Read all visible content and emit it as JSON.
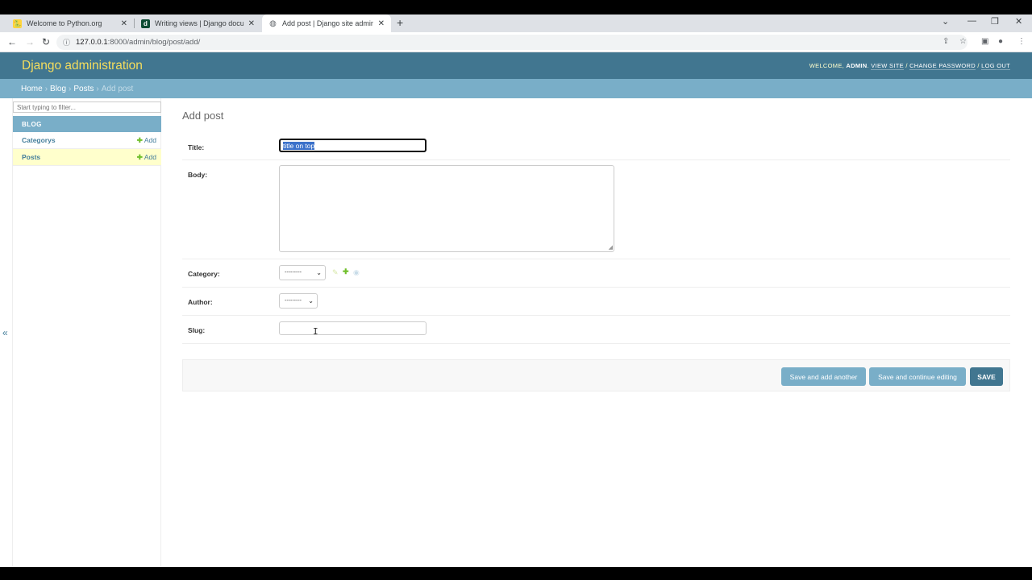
{
  "browser": {
    "tabs": [
      {
        "title": "Welcome to Python.org",
        "favicon": "python-favicon",
        "active": false
      },
      {
        "title": "Writing views | Django documen",
        "favicon": "django-favicon",
        "active": false
      },
      {
        "title": "Add post | Django site admin",
        "favicon": "globe-favicon",
        "active": true
      }
    ],
    "url_host": "127.0.0.1",
    "url_rest": ":8000/admin/blog/post/add/"
  },
  "header": {
    "branding": "Django administration",
    "welcome": "WELCOME,",
    "username": "ADMIN",
    "view_site": "VIEW SITE",
    "change_password": "CHANGE PASSWORD",
    "log_out": "LOG OUT",
    "sep": "/"
  },
  "breadcrumbs": {
    "home": "Home",
    "blog": "Blog",
    "posts": "Posts",
    "current": "Add post",
    "sep": "›"
  },
  "sidebar": {
    "filter_placeholder": "Start typing to filter...",
    "app_caption": "BLOG",
    "models": [
      {
        "name": "Categorys",
        "add_label": "Add",
        "current": false
      },
      {
        "name": "Posts",
        "add_label": "Add",
        "current": true
      }
    ],
    "toggle_glyph": "«"
  },
  "content": {
    "title": "Add post",
    "fields": {
      "title_label": "Title:",
      "title_value": "title on top",
      "body_label": "Body:",
      "body_value": "",
      "category_label": "Category:",
      "category_value": "---------",
      "author_label": "Author:",
      "author_value": "---------",
      "slug_label": "Slug:",
      "slug_value": ""
    },
    "buttons": {
      "save_add_another": "Save and add another",
      "save_continue": "Save and continue editing",
      "save": "SAVE"
    }
  },
  "colors": {
    "header_bg": "#417690",
    "breadcrumb_bg": "#79aec8",
    "branding": "#f5dd5d",
    "add_green": "#70bf2b",
    "current_row": "#ffffcc"
  }
}
